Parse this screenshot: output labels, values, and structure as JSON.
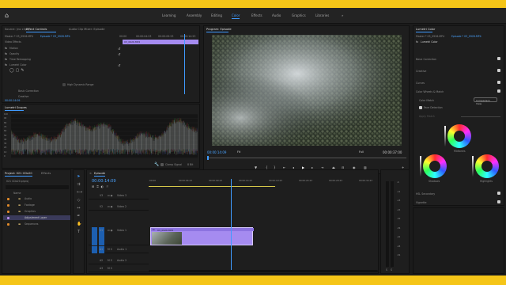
{
  "workspaces": [
    "Learning",
    "Assembly",
    "Editing",
    "Color",
    "Effects",
    "Audio",
    "Graphics",
    "Libraries"
  ],
  "active_workspace": "Color",
  "source_panel": {
    "tabs": [
      "Source: (no clips)",
      "Effect Controls",
      "Audio Clip Mixer: Episode"
    ],
    "active_tab": "Effect Controls",
    "master_label": "Master * 03_0926.MP4",
    "clip_label": "Episode * 03_0926.MP4",
    "ruler_times": [
      "00:00",
      "00:00:04:23",
      "00:00:09:23",
      "00:00:14:23"
    ],
    "clip_name": "03_0926.MP4",
    "video_effects_label": "Video Effects",
    "effects": [
      "Motion",
      "Opacity",
      "Time Remapping",
      "Lumetri Color"
    ],
    "hdr_label": "High Dynamic Range",
    "basic_correction": "Basic Correction",
    "creative": "Creative",
    "timecode": "00:00:14:09"
  },
  "scopes_panel": {
    "title": "Lumetri Scopes",
    "tick_labels": [
      "100",
      "90",
      "80",
      "70",
      "60",
      "50",
      "40",
      "30",
      "20",
      "10",
      "0"
    ],
    "clamp_label": "Clamp Signal",
    "bit_label": "8 Bit"
  },
  "program_panel": {
    "title": "Program: Episode",
    "current_time": "00:00:14:09",
    "fit": "Fit",
    "quality": "Full",
    "duration": "00:00:37:00"
  },
  "lumetri_panel": {
    "tab": "Lumetri Color",
    "master_label": "Master * 03_0926.MP4",
    "clip_label": "Episode * 03_0926.MP4",
    "section_title": "Lumetri Color",
    "sections": [
      "Basic Correction",
      "Creative",
      "Curves",
      "Color Wheels & Match"
    ],
    "color_match": "Color Match",
    "comparison_view": "Comparison View",
    "face_detection": "Face Detection",
    "apply_match": "Apply Match",
    "shadows": "Shadows",
    "midtones": "Midtones",
    "highlights": "Highlights",
    "hsl_secondary": "HSL Secondary",
    "vignette": "Vignette"
  },
  "project_panel": {
    "tabs": [
      "Project: 021 CDx20",
      "Effects"
    ],
    "project_file": "021 CDx20.prproj",
    "search_placeholder": "",
    "column_name": "Name",
    "items": [
      "Audio",
      "Footage",
      "Graphics",
      "Adjustment Layer",
      "Sequences"
    ]
  },
  "timeline_panel": {
    "title": "Episode",
    "timecode": "00:00:14:09",
    "ruler_times": [
      ":00:00",
      "00:00:04:23",
      "00:00:09:23",
      "00:00:14:23",
      "00:00:19:23",
      "00:00:24:23",
      "00:00:29:23",
      "00:00:34:23"
    ],
    "tracks": [
      "V3",
      "V2",
      "V1",
      "A1",
      "A2",
      "A3"
    ],
    "track_names": [
      "Video 3",
      "Video 2",
      "Video 1",
      "Audio 1",
      "Audio 2"
    ],
    "clip_name": "03_0926.MP4",
    "playhead_fraction": 0.36
  },
  "audio_meter": {
    "labels": [
      "S",
      "S"
    ],
    "marks": [
      "-6",
      "-12",
      "-18",
      "-24",
      "-30",
      "-36",
      "-42",
      "-48",
      "-54"
    ]
  },
  "colors": {
    "accent": "#3f9bff",
    "background_frame": "#f5c518",
    "clip_purple": "#a58bf0",
    "track_blue": "#1d5fb0"
  }
}
